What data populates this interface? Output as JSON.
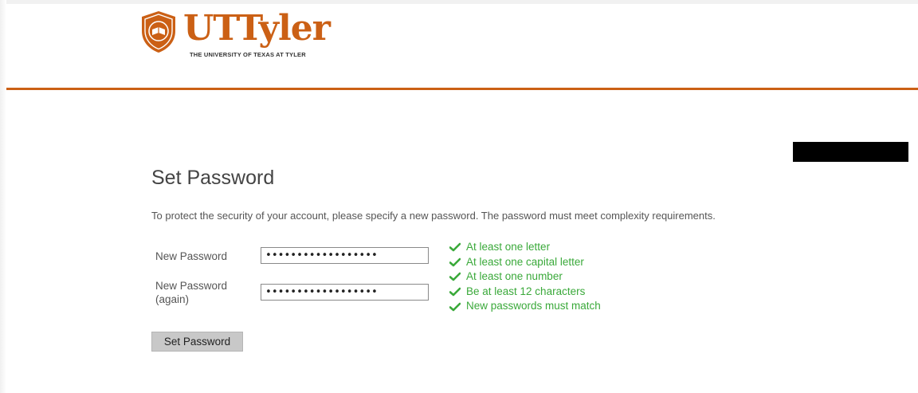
{
  "header": {
    "brand_ut": "UT",
    "brand_tyler": "Tyler",
    "tagline": "THE UNIVERSITY OF TEXAS AT TYLER",
    "accent_color": "#cb6015"
  },
  "form": {
    "title": "Set Password",
    "intro": "To protect the security of your account, please specify a new password. The password must meet complexity requirements.",
    "new_password_label": "New Password",
    "new_password_again_label": "New Password (again)",
    "new_password_value": "••••••••••••••••••",
    "new_password_again_value": "••••••••••••••••••",
    "submit_label": "Set Password"
  },
  "requirements": [
    {
      "text": "At least one letter",
      "icon": "check-icon",
      "met": true
    },
    {
      "text": "At least one capital letter",
      "icon": "check-icon",
      "met": true
    },
    {
      "text": "At least one number",
      "icon": "check-icon",
      "met": true
    },
    {
      "text": "Be at least 12 characters",
      "icon": "check-icon",
      "met": true
    },
    {
      "text": "New passwords must match",
      "icon": "check-icon",
      "met": true
    }
  ],
  "colors": {
    "requirement_met": "#3aa93a",
    "button_bg": "#c8c8c8"
  }
}
